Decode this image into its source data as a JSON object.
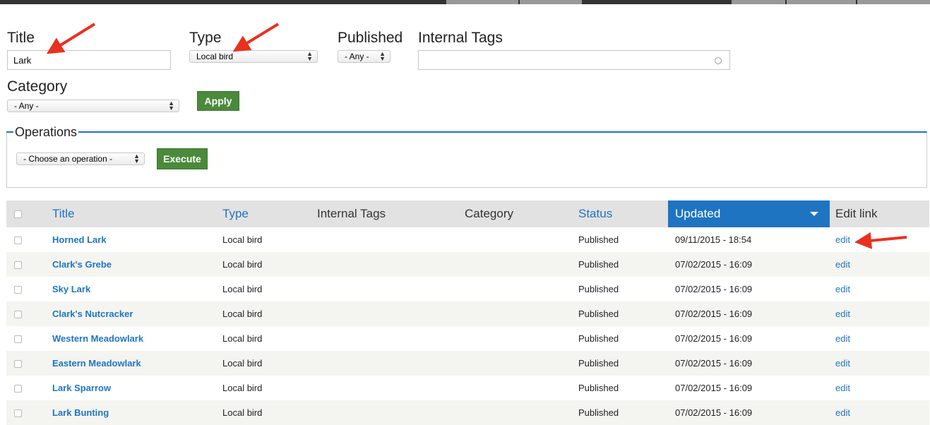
{
  "filters": {
    "title_label": "Title",
    "title_value": "Lark",
    "type_label": "Type",
    "type_value": "Local bird",
    "published_label": "Published",
    "published_value": "- Any -",
    "tags_label": "Internal Tags",
    "tags_value": "",
    "category_label": "Category",
    "category_value": "- Any -",
    "apply_label": "Apply"
  },
  "operations": {
    "legend": "Operations",
    "select_value": "- Choose an operation -",
    "execute_label": "Execute"
  },
  "table": {
    "headers": {
      "title": "Title",
      "type": "Type",
      "internal_tags": "Internal Tags",
      "category": "Category",
      "status": "Status",
      "updated": "Updated",
      "edit_link": "Edit link"
    },
    "rows": [
      {
        "title": "Horned Lark",
        "type": "Local bird",
        "tags": "",
        "category": "",
        "status": "Published",
        "updated": "09/11/2015 - 18:54",
        "edit": "edit"
      },
      {
        "title": "Clark's Grebe",
        "type": "Local bird",
        "tags": "",
        "category": "",
        "status": "Published",
        "updated": "07/02/2015 - 16:09",
        "edit": "edit"
      },
      {
        "title": "Sky Lark",
        "type": "Local bird",
        "tags": "",
        "category": "",
        "status": "Published",
        "updated": "07/02/2015 - 16:09",
        "edit": "edit"
      },
      {
        "title": "Clark's Nutcracker",
        "type": "Local bird",
        "tags": "",
        "category": "",
        "status": "Published",
        "updated": "07/02/2015 - 16:09",
        "edit": "edit"
      },
      {
        "title": "Western Meadowlark",
        "type": "Local bird",
        "tags": "",
        "category": "",
        "status": "Published",
        "updated": "07/02/2015 - 16:09",
        "edit": "edit"
      },
      {
        "title": "Eastern Meadowlark",
        "type": "Local bird",
        "tags": "",
        "category": "",
        "status": "Published",
        "updated": "07/02/2015 - 16:09",
        "edit": "edit"
      },
      {
        "title": "Lark Sparrow",
        "type": "Local bird",
        "tags": "",
        "category": "",
        "status": "Published",
        "updated": "07/02/2015 - 16:09",
        "edit": "edit"
      },
      {
        "title": "Lark Bunting",
        "type": "Local bird",
        "tags": "",
        "category": "",
        "status": "Published",
        "updated": "07/02/2015 - 16:09",
        "edit": "edit"
      }
    ]
  },
  "colors": {
    "accent_blue": "#1f74c2",
    "button_green": "#4a8a3a",
    "annotation_red": "#e8311f"
  }
}
